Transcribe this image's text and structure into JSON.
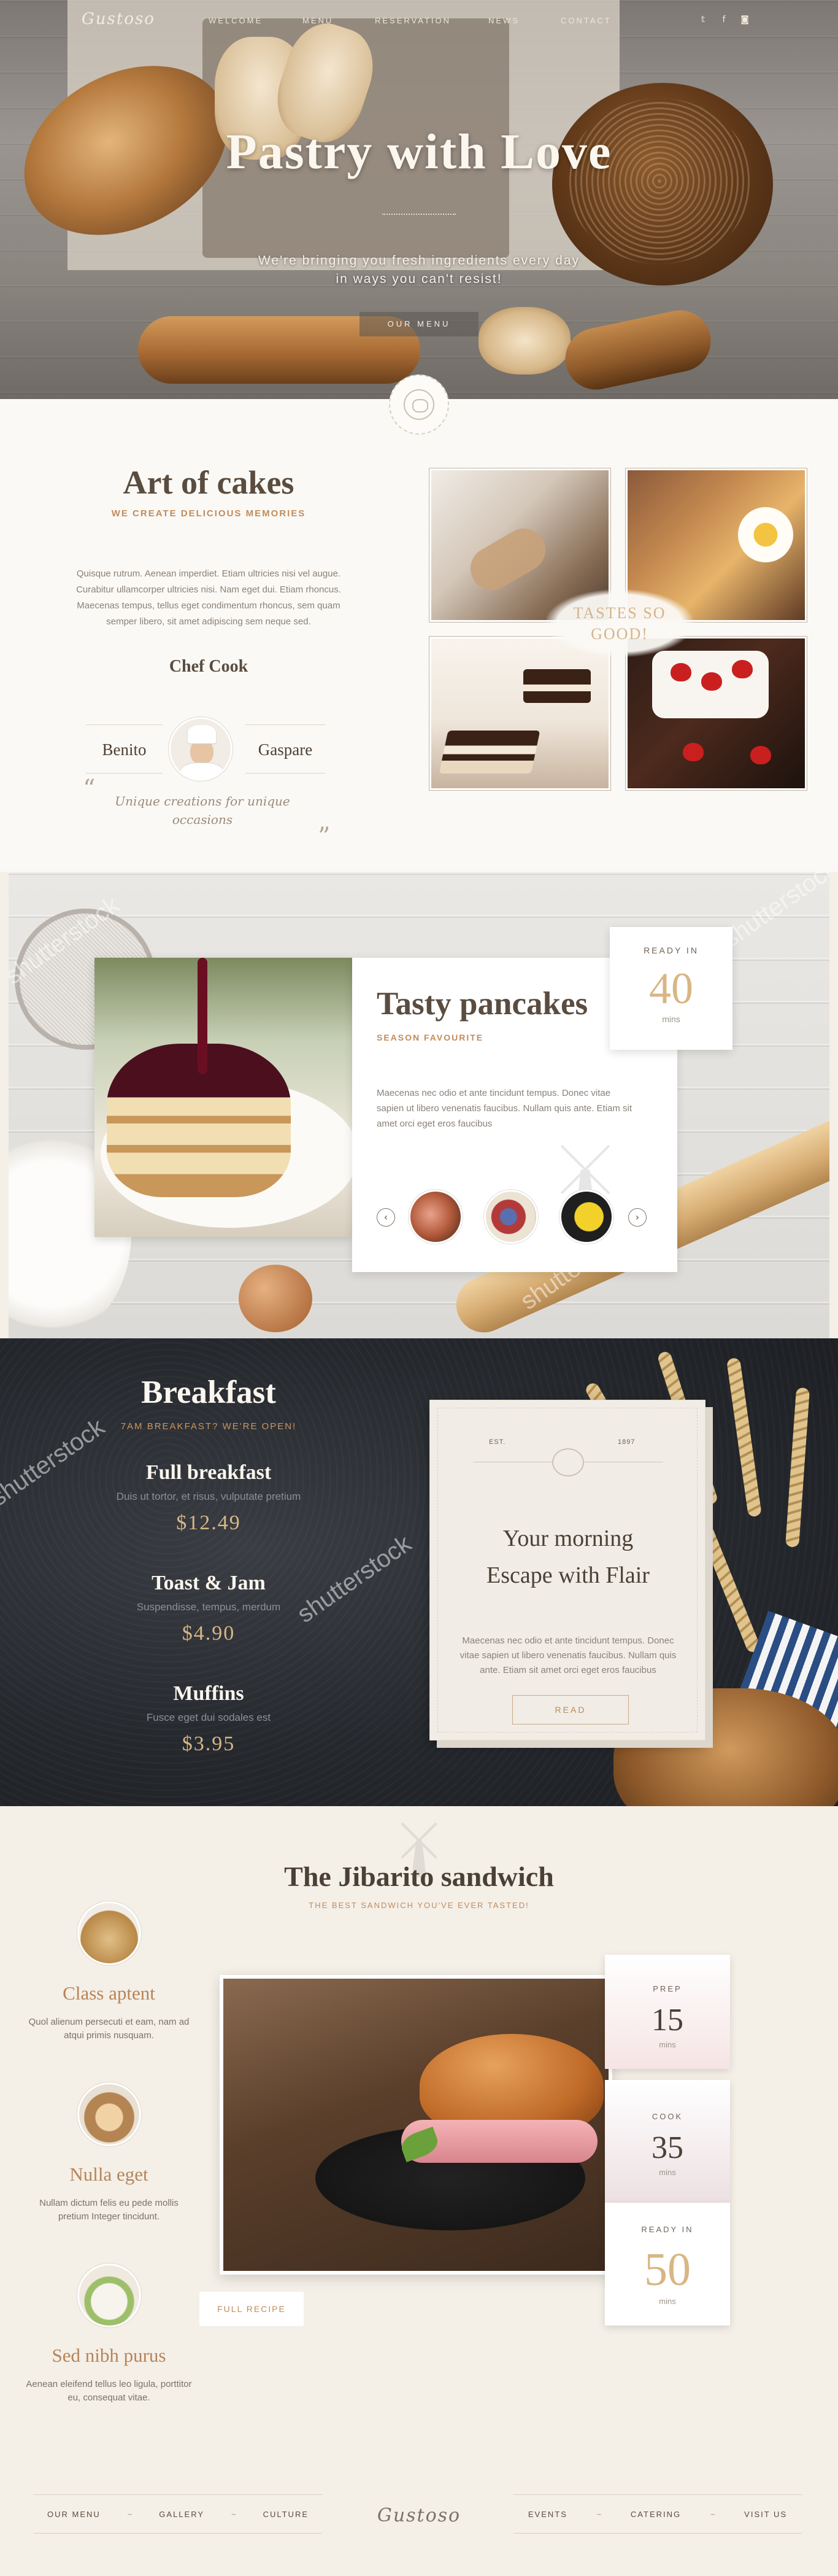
{
  "brand": {
    "logo": "Gustoso"
  },
  "nav": {
    "items": [
      "Welcome",
      "Menu",
      "Reservation",
      "News",
      "Contact"
    ],
    "social": [
      {
        "icon": "twitter-icon",
        "glyph": "𝕥"
      },
      {
        "icon": "facebook-icon",
        "glyph": "f"
      },
      {
        "icon": "instagram-icon",
        "glyph": "◙"
      }
    ]
  },
  "hero": {
    "title": "Pastry with Love",
    "subtitle_line1": "We're bringing you fresh ingredients every day",
    "subtitle_line2": "in ways you can't resist!",
    "button": "OUR MENU"
  },
  "about": {
    "title": "Art of cakes",
    "kicker": "WE CREATE DELICIOUS MEMORIES",
    "text": "Quisque rutrum. Aenean imperdiet. Etiam ultricies nisi vel augue. Curabitur ullamcorper ultricies nisi. Nam eget dui. Etiam rhoncus. Maecenas tempus, tellus eget condimentum rhoncus, sem quam semper libero, sit amet adipiscing sem neque sed.",
    "chef_title": "Chef Cook",
    "chef_left": "Benito",
    "chef_right": "Gaspare",
    "quote_open": "“",
    "quote_close": "”",
    "quote": "Unique creations for unique occasions",
    "tastes_line1": "TASTES SO",
    "tastes_line2": "GOOD!"
  },
  "pancakes": {
    "title": "Tasty pancakes",
    "kicker": "SEASON FAVOURITE",
    "text": "Maecenas nec odio et ante tincidunt tempus. Donec vitae sapien ut libero venenatis faucibus. Nullam quis ante. Etiam sit amet orci eget eros faucibus",
    "prev": "‹",
    "next": "›",
    "ready_label": "READY IN",
    "ready_value": "40",
    "ready_unit": "mins",
    "watermark": "shutterstock"
  },
  "breakfast": {
    "title": "Breakfast",
    "kicker": "7AM BREAKFAST? WE'RE OPEN!",
    "items": [
      {
        "name": "Full breakfast",
        "desc": "Duis ut tortor, et risus, vulputate pretium",
        "price": "$12.49"
      },
      {
        "name": "Toast & Jam",
        "desc": "Suspendisse, tempus, merdum",
        "price": "$4.90"
      },
      {
        "name": "Muffins",
        "desc": "Fusce eget dui sodales est",
        "price": "$3.95"
      }
    ],
    "card": {
      "est": "EST.",
      "year": "1897",
      "title_line1": "Your morning",
      "title_line2": "Escape with Flair",
      "text": "Maecenas nec odio et ante tincidunt tempus. Donec vitae sapien ut libero venenatis faucibus. Nullam quis ante. Etiam sit amet orci eget eros faucibus",
      "button": "READ"
    }
  },
  "sandwich": {
    "title": "The Jibarito sandwich",
    "kicker": "THE BEST SANDWICH YOU'VE EVER TASTED!",
    "features": [
      {
        "title": "Class aptent",
        "text": "Quol alienum persecuti et eam, nam ad atqui primis nusquam."
      },
      {
        "title": "Nulla eget",
        "text": "Nullam dictum felis eu pede mollis pretium Integer tincidunt."
      },
      {
        "title": "Sed nibh purus",
        "text": "Aenean eleifend tellus leo ligula, porttitor eu, consequat vitae."
      }
    ],
    "full_recipe": "FULL RECIPE",
    "timers": [
      {
        "label": "PREP",
        "value": "15",
        "unit": "mins"
      },
      {
        "label": "COOK",
        "value": "35",
        "unit": "mins"
      },
      {
        "label": "READY IN",
        "value": "50",
        "unit": "mins"
      }
    ]
  },
  "footer": {
    "left_links": [
      "OUR MENU",
      "GALLERY",
      "CULTURE"
    ],
    "right_links": [
      "EVENTS",
      "CATERING",
      "VISIT US"
    ],
    "separator": "~",
    "logo": "Gustoso"
  },
  "colors": {
    "accent": "#c18c5c",
    "gold": "#d8b684",
    "dark": "#4a4036",
    "chalkboard": "#25282d"
  }
}
